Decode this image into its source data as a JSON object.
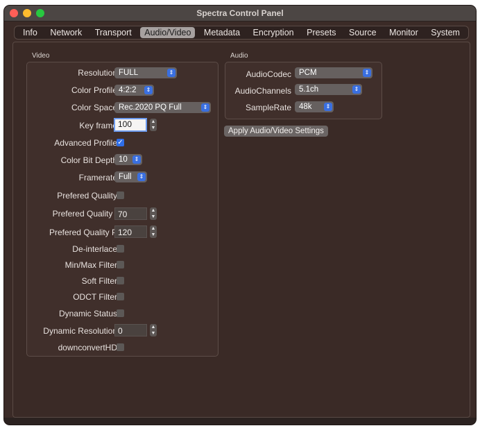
{
  "window": {
    "title": "Spectra Control Panel"
  },
  "tabs": [
    {
      "label": "Info",
      "active": false
    },
    {
      "label": "Network",
      "active": false
    },
    {
      "label": "Transport",
      "active": false
    },
    {
      "label": "Audio/Video",
      "active": true
    },
    {
      "label": "Metadata",
      "active": false
    },
    {
      "label": "Encryption",
      "active": false
    },
    {
      "label": "Presets",
      "active": false
    },
    {
      "label": "Source",
      "active": false
    },
    {
      "label": "Monitor",
      "active": false
    },
    {
      "label": "System",
      "active": false
    }
  ],
  "video": {
    "title": "Video",
    "resolution": {
      "label": "Resolution",
      "value": "FULL"
    },
    "color_profile": {
      "label": "Color Profile",
      "value": "4:2:2"
    },
    "color_space": {
      "label": "Color Space",
      "value": "Rec.2020 PQ Full"
    },
    "key_frame": {
      "label": "Key frame",
      "value": "100"
    },
    "advanced_profile": {
      "label": "Advanced Profile",
      "checked": true
    },
    "color_bit_depth": {
      "label": "Color Bit Depth",
      "value": "10"
    },
    "framerate": {
      "label": "Framerate",
      "value": "Full"
    },
    "prefered_quality": {
      "label": "Prefered Quality",
      "checked": false
    },
    "prefered_quality_i": {
      "label": "Prefered Quality I",
      "value": "70"
    },
    "prefered_quality_p": {
      "label": "Prefered Quality P",
      "value": "120"
    },
    "de_interlace": {
      "label": "De-interlace",
      "checked": false
    },
    "min_max_filter": {
      "label": "Min/Max Filter",
      "checked": false
    },
    "soft_filter": {
      "label": "Soft Filter",
      "checked": false
    },
    "odct_filter": {
      "label": "ODCT Filter",
      "checked": false
    },
    "dynamic_status": {
      "label": "Dynamic Status",
      "checked": false
    },
    "dynamic_resolution": {
      "label": "Dynamic Resolution",
      "value": "0"
    },
    "downconvert_hd": {
      "label": "downconvertHD",
      "checked": false
    }
  },
  "audio": {
    "title": "Audio",
    "codec": {
      "label": "AudioCodec",
      "value": "PCM"
    },
    "channels": {
      "label": "AudioChannels",
      "value": "5.1ch"
    },
    "sample_rate": {
      "label": "SampleRate",
      "value": "48k"
    }
  },
  "apply_button": "Apply Audio/Video Settings",
  "icons": {
    "chevron": "up-down-chevron-icon",
    "check": "checkmark-icon"
  }
}
